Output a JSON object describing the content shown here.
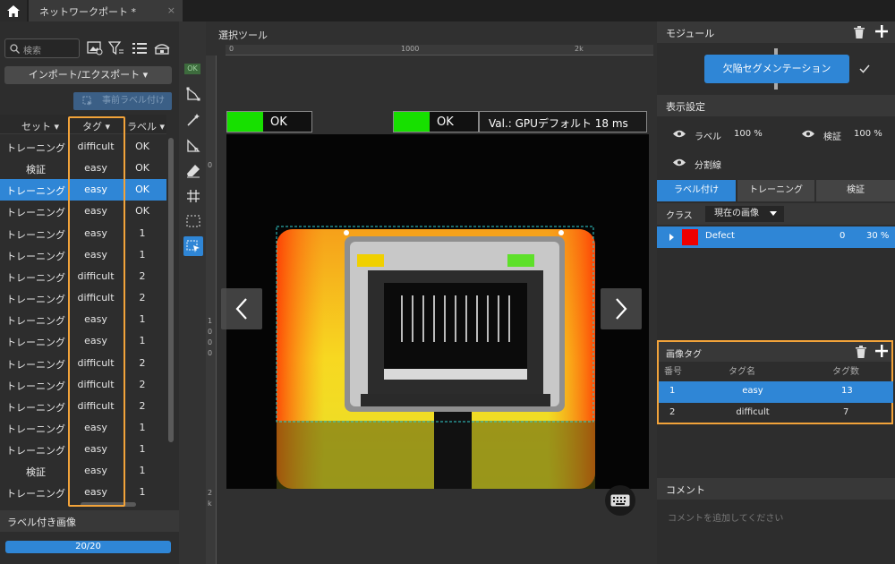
{
  "tab": {
    "title": "ネットワークポート *",
    "close": "×"
  },
  "left": {
    "search_placeholder": "検索",
    "import_export": "インポート/エクスポート ▾",
    "pre_label": "事前ラベル付け",
    "headers": {
      "set": "セット",
      "tag": "タグ",
      "label": "ラベル"
    },
    "rows": [
      {
        "set": "トレーニング",
        "tag": "difficult",
        "label": "OK"
      },
      {
        "set": "検証",
        "tag": "easy",
        "label": "OK"
      },
      {
        "set": "トレーニング",
        "tag": "easy",
        "label": "OK"
      },
      {
        "set": "トレーニング",
        "tag": "easy",
        "label": "OK"
      },
      {
        "set": "トレーニング",
        "tag": "easy",
        "label": "1"
      },
      {
        "set": "トレーニング",
        "tag": "easy",
        "label": "1"
      },
      {
        "set": "トレーニング",
        "tag": "difficult",
        "label": "2"
      },
      {
        "set": "トレーニング",
        "tag": "difficult",
        "label": "2"
      },
      {
        "set": "トレーニング",
        "tag": "easy",
        "label": "1"
      },
      {
        "set": "トレーニング",
        "tag": "easy",
        "label": "1"
      },
      {
        "set": "トレーニング",
        "tag": "difficult",
        "label": "2"
      },
      {
        "set": "トレーニング",
        "tag": "difficult",
        "label": "2"
      },
      {
        "set": "トレーニング",
        "tag": "difficult",
        "label": "2"
      },
      {
        "set": "トレーニング",
        "tag": "easy",
        "label": "1"
      },
      {
        "set": "トレーニング",
        "tag": "easy",
        "label": "1"
      },
      {
        "set": "検証",
        "tag": "easy",
        "label": "1"
      },
      {
        "set": "トレーニング",
        "tag": "easy",
        "label": "1"
      }
    ],
    "selected_row": 2,
    "labeled_images": "ラベル付き画像",
    "progress": "20/20"
  },
  "tools": {
    "ok_badge": "OK"
  },
  "center": {
    "title": "選択ツール",
    "ruler_top": [
      "0",
      "1000",
      "2k"
    ],
    "ruler_left": [
      "0",
      "1",
      "0",
      "0",
      "0",
      "2",
      "k"
    ],
    "ok_left": "OK",
    "ok_right": "OK",
    "val_text": "Val.:  GPUデフォルト 18 ms"
  },
  "right": {
    "module_title": "モジュール",
    "module_btn": "欠陥セグメンテーション",
    "display_title": "表示設定",
    "label_text": "ラベル",
    "label_pct": "100 %",
    "verify_text": "検証",
    "verify_pct": "100 %",
    "split_text": "分割線",
    "tabs": [
      "ラベル付け",
      "トレーニング",
      "検証"
    ],
    "class_label": "クラス",
    "class_select": "現在の画像",
    "class_row": {
      "name": "Defect",
      "count": "0",
      "pct": "30 %"
    },
    "imgtag_title": "画像タグ",
    "imgtag_headers": {
      "no": "番号",
      "name": "タグ名",
      "count": "タグ数"
    },
    "imgtag_rows": [
      {
        "no": "1",
        "name": "easy",
        "count": "13"
      },
      {
        "no": "2",
        "name": "difficult",
        "count": "7"
      }
    ],
    "comment_title": "コメント",
    "comment_placeholder": "コメントを追加してください"
  }
}
